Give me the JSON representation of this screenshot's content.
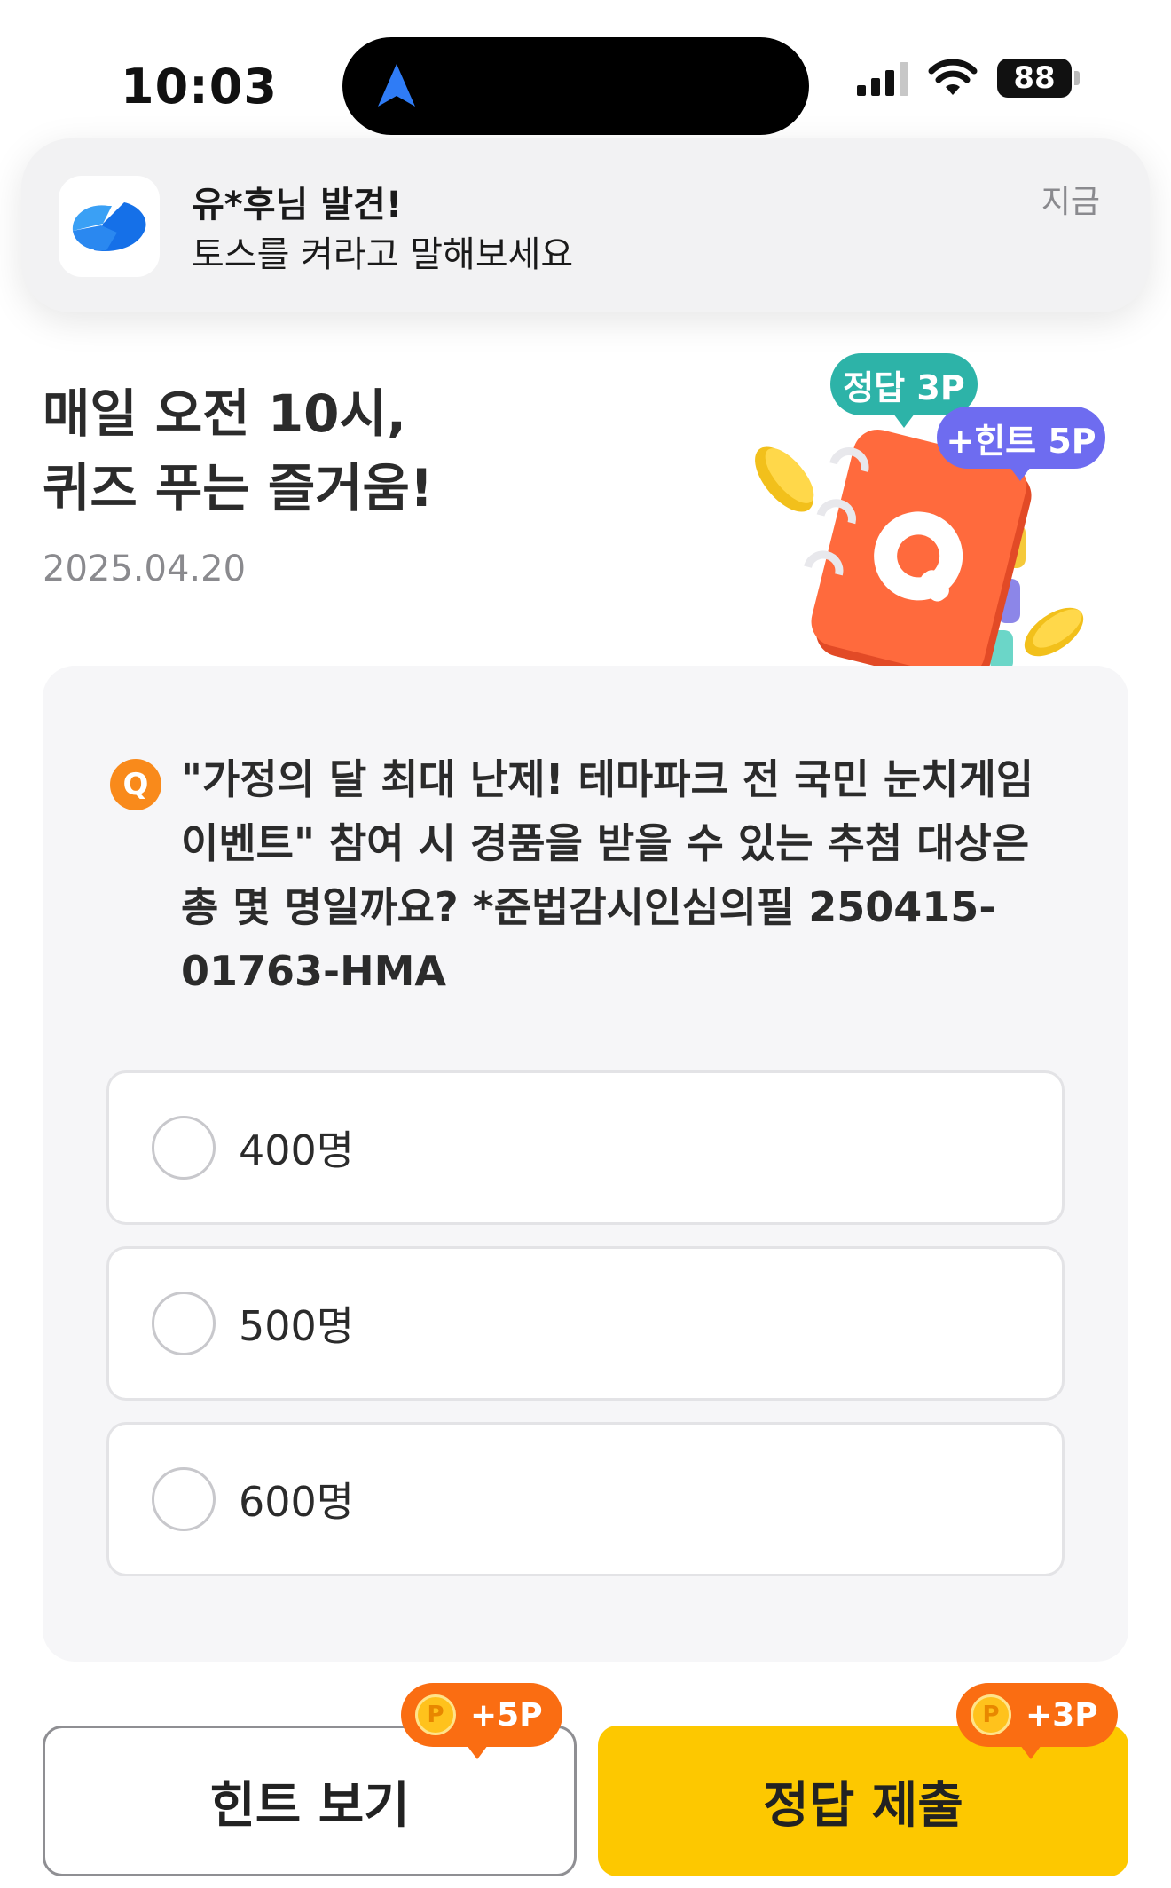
{
  "status_bar": {
    "time": "10:03",
    "battery": "88"
  },
  "notification": {
    "title": "유*후님 발견!",
    "body": "토스를 켜라고 말해보세요",
    "time": "지금"
  },
  "header": {
    "headline_line1": "매일 오전 10시,",
    "headline_line2": "퀴즈 푸는 즐거움!",
    "date": "2025.04.20"
  },
  "illustration": {
    "answer_bubble": "정답 3P",
    "hint_bubble": "+힌트 5P",
    "book_letter": "Q"
  },
  "quiz": {
    "badge": "Q",
    "question": "\"가정의 달 최대 난제! 테마파크 전 국민 눈치게임 이벤트\" 참여 시 경품을 받을 수 있는 추첨 대상은 총 몇 명일까요? *준법감시인심의필 250415-01763-HMA",
    "options": [
      {
        "label": "400명"
      },
      {
        "label": "500명"
      },
      {
        "label": "600명"
      }
    ]
  },
  "actions": {
    "hint_label": "힌트 보기",
    "hint_reward": "+5P",
    "submit_label": "정답 제출",
    "submit_reward": "+3P",
    "coin_symbol": "P"
  },
  "colors": {
    "accent_yellow": "#fdc800",
    "reward_orange": "#fa6d12",
    "answer_teal": "#2db3a8",
    "hint_purple": "#6e6cf0",
    "book_orange": "#ff6a3d"
  },
  "icons": {
    "island": "navigation-arrow-icon",
    "app": "toss-logo-icon"
  }
}
